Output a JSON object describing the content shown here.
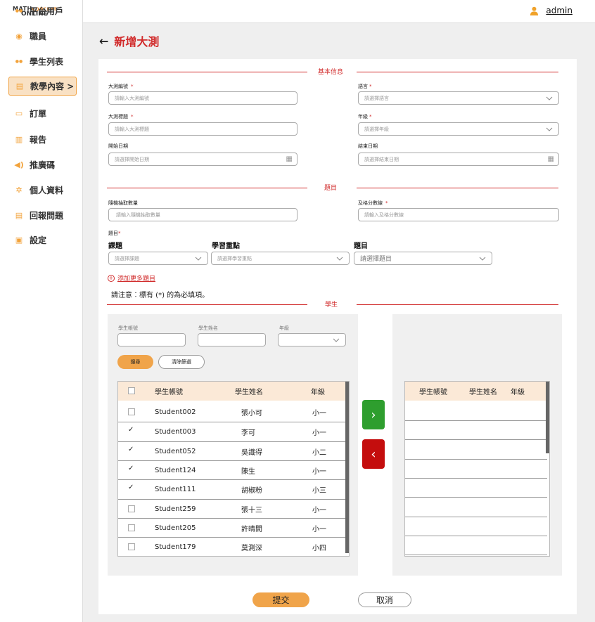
{
  "logo": {
    "line1_a": "MATH",
    "line1_b": "CONCEPT",
    "line2": "ONLINE"
  },
  "sidebar": {
    "items": [
      {
        "label": "平台用戶",
        "icon": "users-icon"
      },
      {
        "label": "職員",
        "icon": "staff-icon"
      },
      {
        "label": "學生列表",
        "icon": "students-icon"
      },
      {
        "label": "教學內容 >",
        "icon": "book-icon"
      },
      {
        "label": "訂單",
        "icon": "order-icon"
      },
      {
        "label": "報告",
        "icon": "chart-icon"
      },
      {
        "label": "推廣碼",
        "icon": "megaphone-icon"
      },
      {
        "label": "個人資料",
        "icon": "gear-icon"
      },
      {
        "label": "回報問題",
        "icon": "report-icon"
      },
      {
        "label": "設定",
        "icon": "settings-icon"
      }
    ]
  },
  "header": {
    "username": "admin"
  },
  "page": {
    "back": "←",
    "title": "新增大測"
  },
  "sections": {
    "basic": "基本信息",
    "questions": "題目",
    "students": "學生"
  },
  "form": {
    "exam_no": {
      "label": "大測編號",
      "placeholder": "請輸入大測編號"
    },
    "language": {
      "label": "語言",
      "placeholder": "請選擇語言"
    },
    "exam_title": {
      "label": "大測標題",
      "placeholder": "請輸入大測標題"
    },
    "grade": {
      "label": "年級",
      "placeholder": "請選擇年級"
    },
    "start_date": {
      "label": "開始日期",
      "placeholder": "請選擇開始日期"
    },
    "end_date": {
      "label": "結束日期",
      "placeholder": "請選擇結束日期"
    },
    "random_count": {
      "label": "隨機抽取數量",
      "placeholder": "請輸入隨機抽取數量"
    },
    "pass_score": {
      "label": "及格分數線",
      "placeholder": "請輸入及格分數線"
    },
    "required_mark": "*"
  },
  "questions": {
    "label": "題目",
    "col_topic": "課題",
    "col_focus": "學習重點",
    "col_question": "題目",
    "topic_placeholder": "請選擇課題",
    "focus_placeholder": "請選擇學習重點",
    "question_placeholder": "請選擇題目",
    "add_more": "添加更多題目",
    "note": "請注意︰標有 (*) 的為必填項。"
  },
  "filters": {
    "account_label": "學生帳號",
    "name_label": "學生姓名",
    "grade_label": "年級",
    "search": "搜尋",
    "clear": "清除篩選"
  },
  "left_table": {
    "headers": [
      "學生帳號",
      "學生姓名",
      "年級"
    ],
    "rows": [
      {
        "account": "Student002",
        "name": "張小可",
        "grade": "小一",
        "checked": false
      },
      {
        "account": "Student003",
        "name": "李可",
        "grade": "小一",
        "checked": true
      },
      {
        "account": "Student052",
        "name": "吳識得",
        "grade": "小二",
        "checked": true
      },
      {
        "account": "Student124",
        "name": "陳生",
        "grade": "小一",
        "checked": true
      },
      {
        "account": "Student111",
        "name": "胡椒粉",
        "grade": "小三",
        "checked": true
      },
      {
        "account": "Student259",
        "name": "張十三",
        "grade": "小一",
        "checked": false
      },
      {
        "account": "Student205",
        "name": "許晴間",
        "grade": "小一",
        "checked": false
      },
      {
        "account": "Student179",
        "name": "莫測深",
        "grade": "小四",
        "checked": false
      }
    ]
  },
  "right_table": {
    "headers": [
      "學生帳號",
      "學生姓名",
      "年級"
    ]
  },
  "transfer": {
    "right": "›",
    "left": "‹"
  },
  "colors": {
    "accent": "#d12b2b",
    "orange": "#f0a44a",
    "green": "#2e9e2e",
    "red": "#c40d0d"
  },
  "actions": {
    "submit": "提交",
    "cancel": "取消"
  }
}
